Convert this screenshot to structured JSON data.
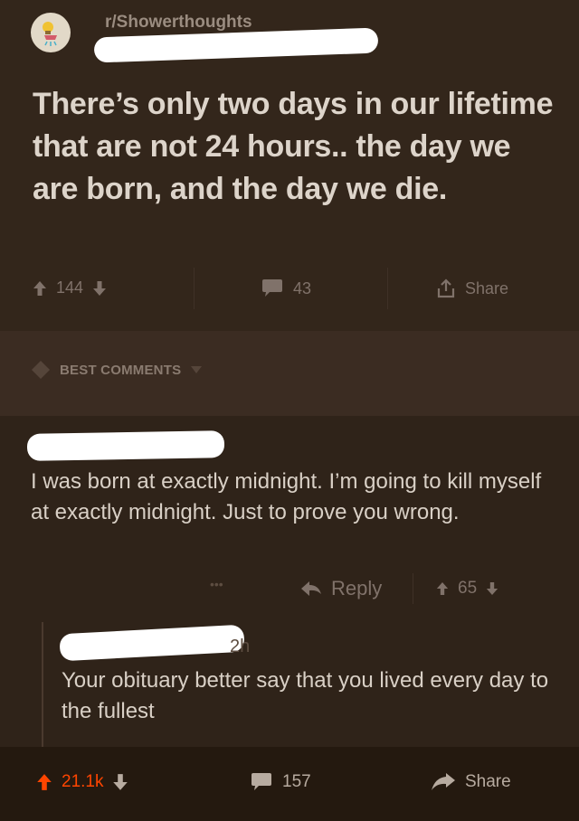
{
  "post": {
    "subreddit": "r/Showerthoughts",
    "title": "There’s only two days in our lifetime that are not 24 hours.. the day we are born, and the day we die.",
    "upvotes": "144",
    "comments": "43",
    "share_label": "Share"
  },
  "sort": {
    "label": "BEST COMMENTS"
  },
  "comment": {
    "body": "I was born at exactly midnight. I’m going to kill myself at exactly midnight. Just to prove you wrong.",
    "more_label": "•••",
    "reply_label": "Reply",
    "score": "65"
  },
  "reply": {
    "age": "2h",
    "body": "Your obituary better say that you lived every day to the fullest"
  },
  "bottom_bar": {
    "upvotes": "21.1k",
    "comments": "157",
    "share_label": "Share"
  },
  "colors": {
    "upvote_active": "#ff4500",
    "muted_icon": "#80726a",
    "background": "#2f2319"
  }
}
